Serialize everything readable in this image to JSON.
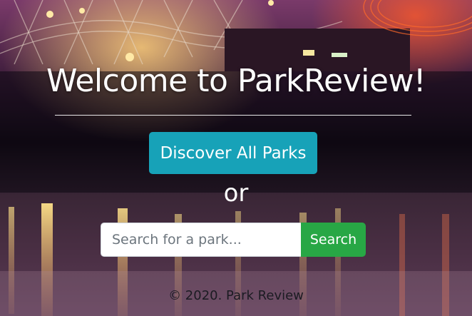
{
  "hero": {
    "title": "Welcome to ParkReview!",
    "discover_button": "Discover All Parks",
    "or_text": "or"
  },
  "search": {
    "placeholder": "Search for a park...",
    "value": "",
    "button_label": "Search"
  },
  "footer": {
    "text": "© 2020. Park Review"
  },
  "colors": {
    "discover_button": "#17a2b8",
    "search_button": "#28a745",
    "text": "#ffffff"
  }
}
